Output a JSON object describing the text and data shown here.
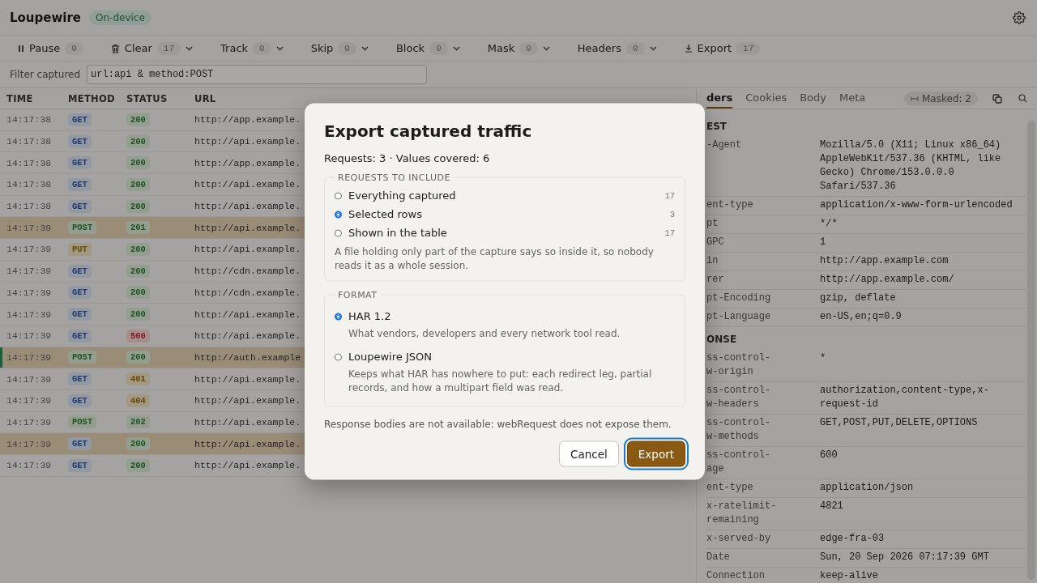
{
  "app": {
    "title": "Loupewire",
    "badge": "On-device"
  },
  "toolbar": [
    {
      "kind": "pause",
      "label": "Pause",
      "count": "0",
      "dropdown": false
    },
    {
      "kind": "clear",
      "label": "Clear",
      "count": "17",
      "dropdown": true
    },
    {
      "kind": "plain",
      "label": "Track",
      "count": "0",
      "dropdown": true
    },
    {
      "kind": "plain",
      "label": "Skip",
      "count": "0",
      "dropdown": true
    },
    {
      "kind": "plain",
      "label": "Block",
      "count": "0",
      "dropdown": true
    },
    {
      "kind": "plain",
      "label": "Mask",
      "count": "0",
      "dropdown": true
    },
    {
      "kind": "plain",
      "label": "Headers",
      "count": "0",
      "dropdown": true
    },
    {
      "kind": "export",
      "label": "Export",
      "count": "17",
      "dropdown": false
    }
  ],
  "filter": {
    "label": "Filter captured",
    "value": "url:api & method:POST"
  },
  "table": {
    "columns": [
      "TIME",
      "METHOD",
      "STATUS",
      "URL"
    ],
    "rows": [
      {
        "time": "14:17:38",
        "method": {
          "label": "GET",
          "kind": "get"
        },
        "status": {
          "label": "200",
          "kind": "ok"
        },
        "url": "http://app.example.",
        "selected": false,
        "current": false
      },
      {
        "time": "14:17:38",
        "method": {
          "label": "GET",
          "kind": "get"
        },
        "status": {
          "label": "200",
          "kind": "ok"
        },
        "url": "http://api.example.",
        "selected": false,
        "current": false
      },
      {
        "time": "14:17:38",
        "method": {
          "label": "GET",
          "kind": "get"
        },
        "status": {
          "label": "200",
          "kind": "ok"
        },
        "url": "http://app.example.",
        "selected": false,
        "current": false
      },
      {
        "time": "14:17:38",
        "method": {
          "label": "GET",
          "kind": "get"
        },
        "status": {
          "label": "200",
          "kind": "ok"
        },
        "url": "http://api.example.",
        "selected": false,
        "current": false
      },
      {
        "time": "14:17:38",
        "method": {
          "label": "GET",
          "kind": "get"
        },
        "status": {
          "label": "200",
          "kind": "ok"
        },
        "url": "http://api.example.",
        "selected": false,
        "current": false
      },
      {
        "time": "14:17:39",
        "method": {
          "label": "POST",
          "kind": "post"
        },
        "status": {
          "label": "201",
          "kind": "ok"
        },
        "url": "http://api.example.",
        "selected": true,
        "current": false
      },
      {
        "time": "14:17:39",
        "method": {
          "label": "PUT",
          "kind": "put"
        },
        "status": {
          "label": "200",
          "kind": "ok"
        },
        "url": "http://api.example.",
        "selected": false,
        "current": false
      },
      {
        "time": "14:17:39",
        "method": {
          "label": "GET",
          "kind": "get"
        },
        "status": {
          "label": "200",
          "kind": "ok"
        },
        "url": "http://cdn.example.",
        "selected": false,
        "current": false
      },
      {
        "time": "14:17:39",
        "method": {
          "label": "GET",
          "kind": "get"
        },
        "status": {
          "label": "200",
          "kind": "ok"
        },
        "url": "http://cdn.example.",
        "selected": false,
        "current": false
      },
      {
        "time": "14:17:39",
        "method": {
          "label": "GET",
          "kind": "get"
        },
        "status": {
          "label": "200",
          "kind": "ok"
        },
        "url": "http://api.example.",
        "selected": false,
        "current": false
      },
      {
        "time": "14:17:39",
        "method": {
          "label": "GET",
          "kind": "get"
        },
        "status": {
          "label": "500",
          "kind": "error"
        },
        "url": "http://api.example.",
        "selected": false,
        "current": false
      },
      {
        "time": "14:17:39",
        "method": {
          "label": "POST",
          "kind": "post"
        },
        "status": {
          "label": "200",
          "kind": "ok"
        },
        "url": "http://auth.example",
        "selected": true,
        "current": true
      },
      {
        "time": "14:17:39",
        "method": {
          "label": "GET",
          "kind": "get"
        },
        "status": {
          "label": "401",
          "kind": "warn"
        },
        "url": "http://api.example.",
        "selected": false,
        "current": false
      },
      {
        "time": "14:17:39",
        "method": {
          "label": "GET",
          "kind": "get"
        },
        "status": {
          "label": "404",
          "kind": "warn"
        },
        "url": "http://api.example.",
        "selected": false,
        "current": false
      },
      {
        "time": "14:17:39",
        "method": {
          "label": "POST",
          "kind": "post"
        },
        "status": {
          "label": "202",
          "kind": "ok"
        },
        "url": "http://api.example.",
        "selected": false,
        "current": false
      },
      {
        "time": "14:17:39",
        "method": {
          "label": "GET",
          "kind": "get"
        },
        "status": {
          "label": "200",
          "kind": "ok"
        },
        "url": "http://api.example.",
        "selected": true,
        "current": false
      },
      {
        "time": "14:17:39",
        "method": {
          "label": "GET",
          "kind": "get"
        },
        "status": {
          "label": "200",
          "kind": "ok"
        },
        "url": "http://api.example.",
        "selected": false,
        "current": false
      }
    ]
  },
  "detail": {
    "tabs": [
      {
        "label": "ders",
        "selected": true
      },
      {
        "label": "Cookies",
        "selected": false
      },
      {
        "label": "Body",
        "selected": false
      },
      {
        "label": "Meta",
        "selected": false
      }
    ],
    "masked": "Masked: 2",
    "sections": [
      {
        "title": "EST",
        "rows": [
          {
            "name": "-Agent",
            "value": "Mozilla/5.0 (X11; Linux x86_64) AppleWebKit/537.36 (KHTML, like Gecko) Chrome/153.0.0.0 Safari/537.36"
          },
          {
            "name": "ent-type",
            "value": "application/x-www-form-urlencoded"
          },
          {
            "name": "pt",
            "value": "*/*"
          },
          {
            "name": "GPC",
            "value": "1"
          },
          {
            "name": "in",
            "value": "http://app.example.com"
          },
          {
            "name": "rer",
            "value": "http://app.example.com/"
          },
          {
            "name": "pt-Encoding",
            "value": "gzip, deflate"
          },
          {
            "name": "pt-Language",
            "value": "en-US,en;q=0.9"
          }
        ]
      },
      {
        "title": "ONSE",
        "rows": [
          {
            "name": "ss-control-\nw-origin",
            "value": "*"
          },
          {
            "name": "ss-control-\nw-headers",
            "value": "authorization,content-type,x-request-id"
          },
          {
            "name": "ss-control-\nw-methods",
            "value": "GET,POST,PUT,DELETE,OPTIONS"
          },
          {
            "name": "ss-control-\nage",
            "value": "600"
          },
          {
            "name": "ent-type",
            "value": "application/json"
          },
          {
            "name": "x-ratelimit-\nremaining",
            "value": "4821"
          },
          {
            "name": "x-served-by",
            "value": "edge-fra-03"
          },
          {
            "name": "Date",
            "value": "Sun, 20 Sep 2026 07:17:39 GMT"
          },
          {
            "name": "Connection",
            "value": "keep-alive"
          }
        ]
      }
    ]
  },
  "dialog": {
    "title": "Export captured traffic",
    "summary": "Requests: 3 · Values covered: 6",
    "include": {
      "legend": "REQUESTS TO INCLUDE",
      "options": [
        {
          "label": "Everything captured",
          "count": "17",
          "selected": false
        },
        {
          "label": "Selected rows",
          "count": "3",
          "selected": true
        },
        {
          "label": "Shown in the table",
          "count": "17",
          "selected": false
        }
      ],
      "note": "A file holding only part of the capture says so inside it, so nobody reads it as a whole session."
    },
    "format": {
      "legend": "FORMAT",
      "options": [
        {
          "label": "HAR 1.2",
          "description": "What vendors, developers and every network tool read.",
          "selected": true
        },
        {
          "label": "Loupewire JSON",
          "description": "Keeps what HAR has nowhere to put: each redirect leg, partial records, and how a multipart field was read.",
          "selected": false
        }
      ]
    },
    "footnote": "Response bodies are not available: webRequest does not expose them.",
    "buttons": [
      {
        "label": "Cancel",
        "kind": "secondary"
      },
      {
        "label": "Export",
        "kind": "primary"
      }
    ]
  }
}
